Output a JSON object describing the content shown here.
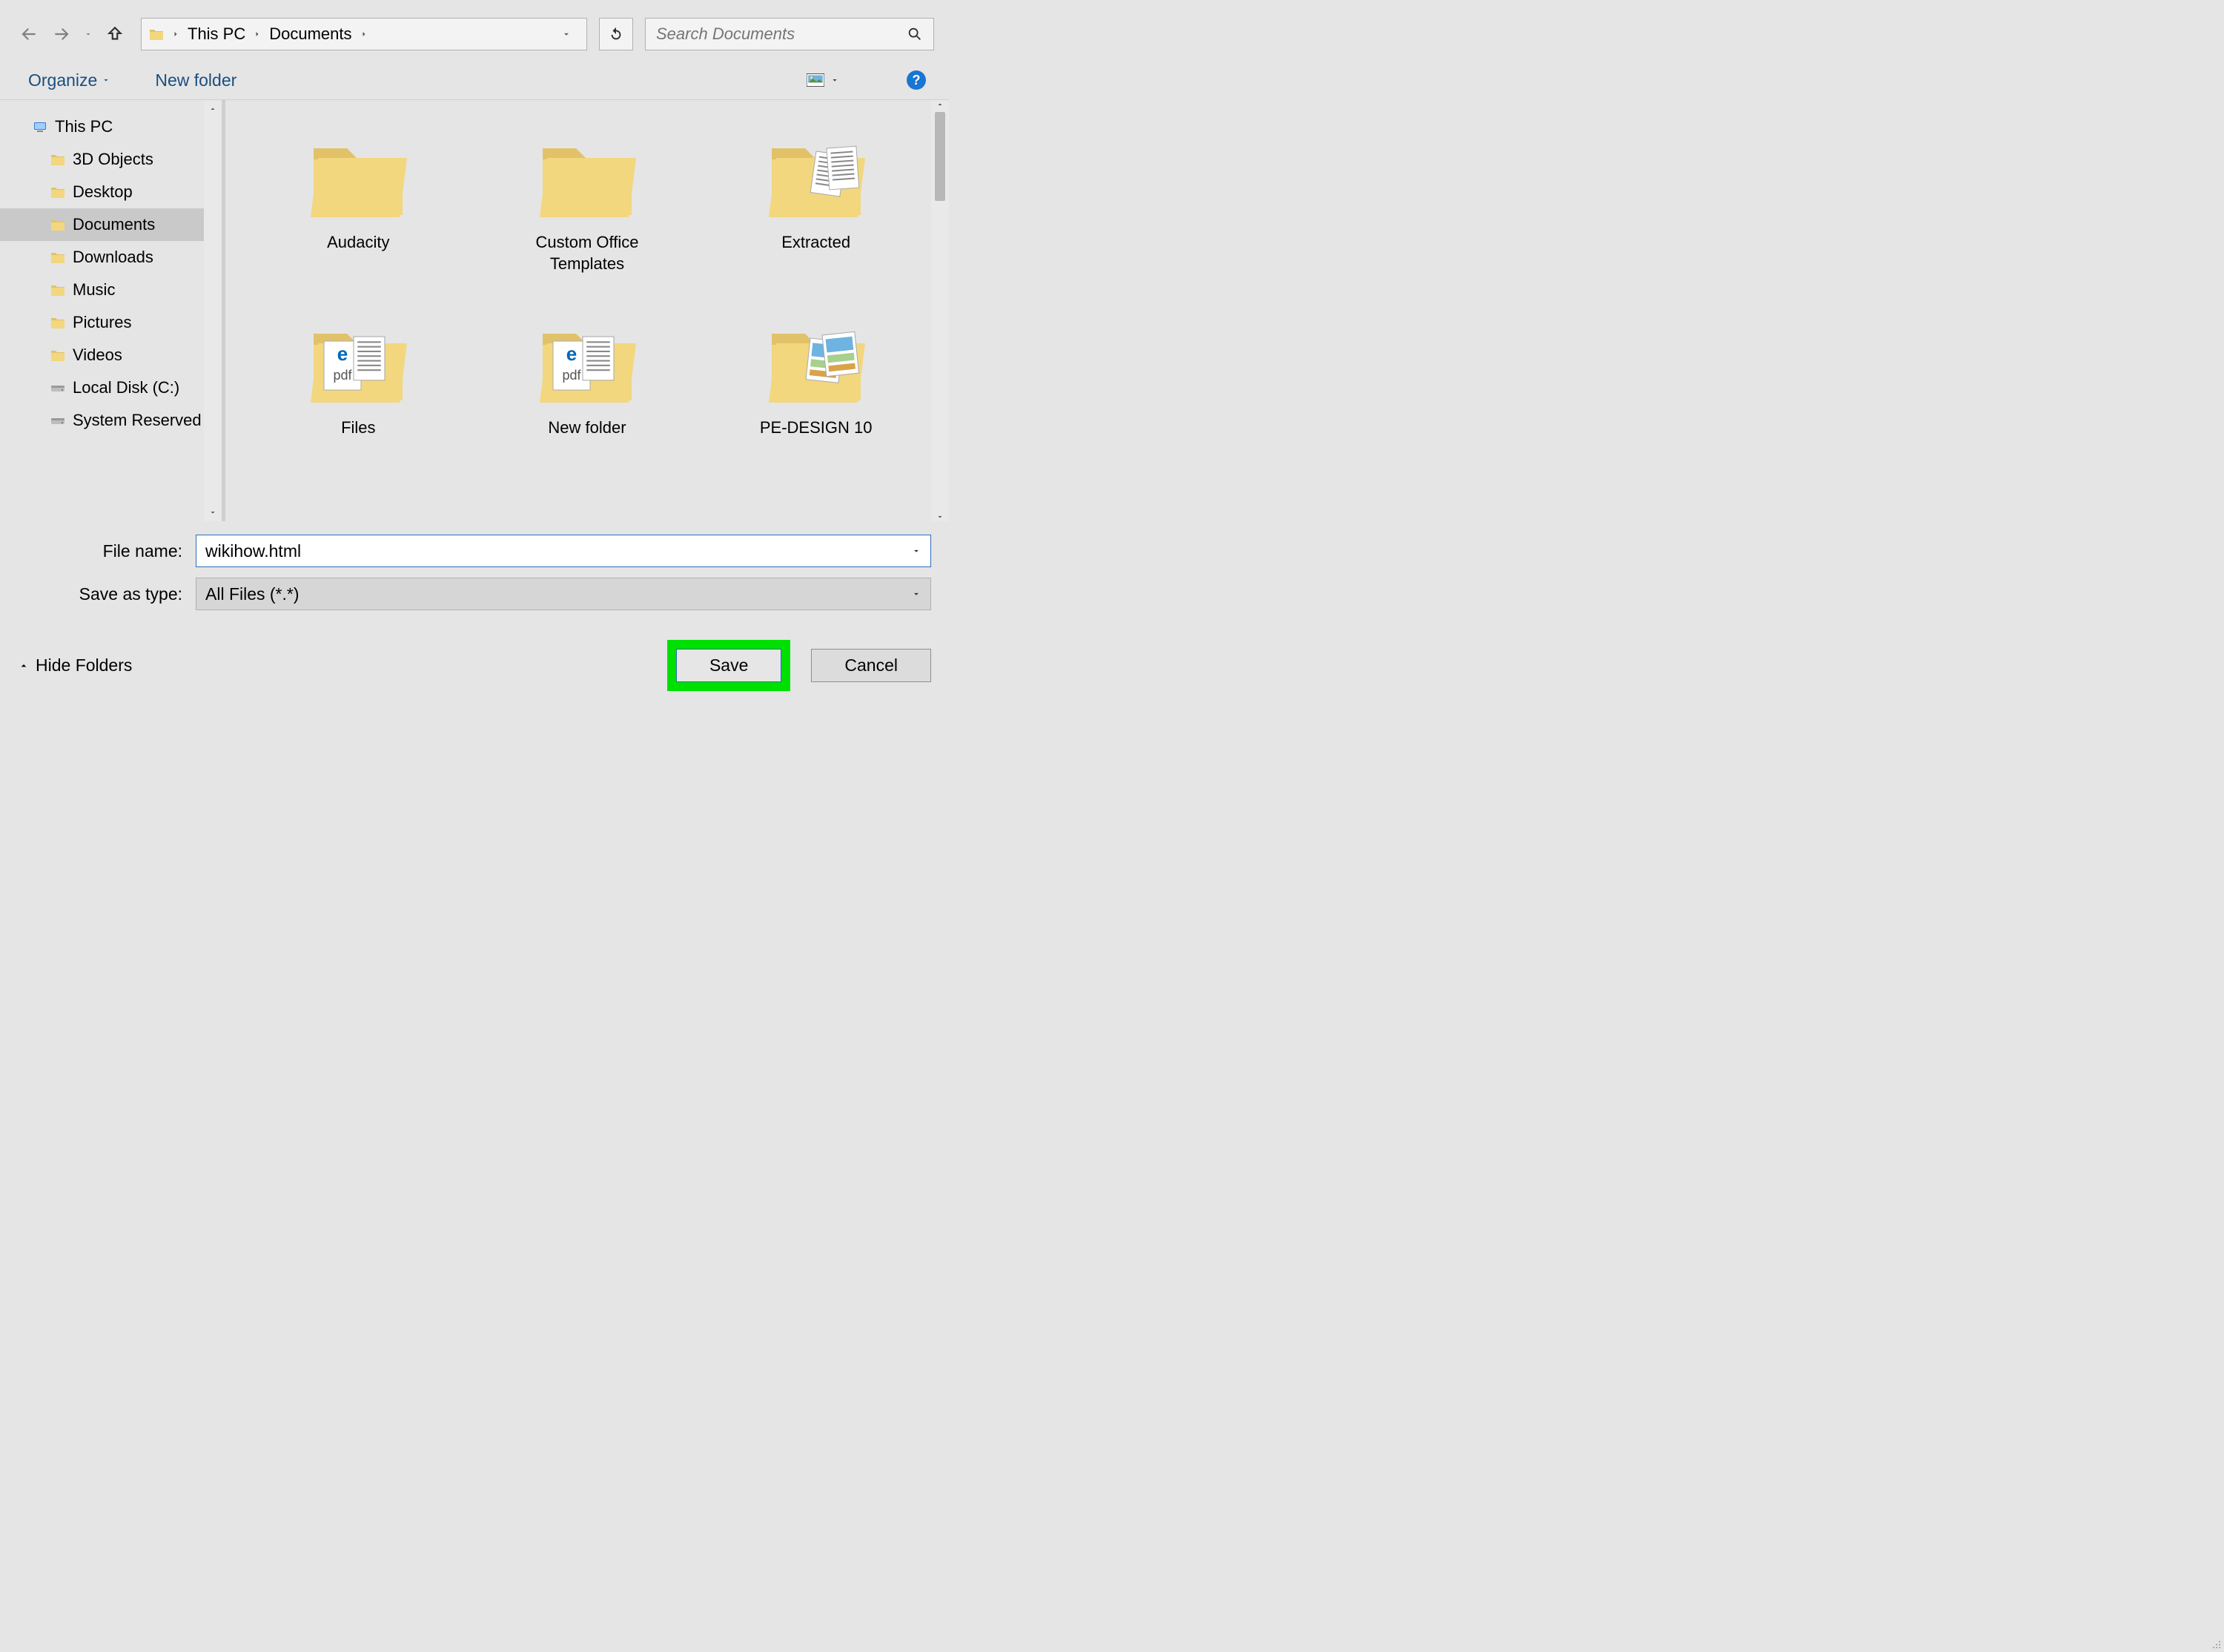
{
  "address": {
    "segments": [
      "This PC",
      "Documents"
    ]
  },
  "search": {
    "placeholder": "Search Documents"
  },
  "toolbar": {
    "organize_label": "Organize",
    "new_folder_label": "New folder"
  },
  "tree": {
    "items": [
      {
        "label": "This PC",
        "icon": "pc"
      },
      {
        "label": "3D Objects",
        "icon": "folder"
      },
      {
        "label": "Desktop",
        "icon": "folder"
      },
      {
        "label": "Documents",
        "icon": "folder",
        "selected": true
      },
      {
        "label": "Downloads",
        "icon": "folder"
      },
      {
        "label": "Music",
        "icon": "folder"
      },
      {
        "label": "Pictures",
        "icon": "folder"
      },
      {
        "label": "Videos",
        "icon": "folder"
      },
      {
        "label": "Local Disk (C:)",
        "icon": "drive"
      },
      {
        "label": "System Reserved",
        "icon": "drive"
      }
    ]
  },
  "files": [
    {
      "label": "Audacity",
      "icon": "folder"
    },
    {
      "label": "Custom Office Templates",
      "icon": "folder"
    },
    {
      "label": "Extracted",
      "icon": "folder-doc"
    },
    {
      "label": "Files",
      "icon": "folder-edge-pdf"
    },
    {
      "label": "New folder",
      "icon": "folder-edge-pdf"
    },
    {
      "label": "PE-DESIGN 10",
      "icon": "folder-images"
    }
  ],
  "form": {
    "filename_label": "File name:",
    "type_label": "Save as type:",
    "filename_value": "wikihow.html",
    "type_value": "All Files  (*.*)"
  },
  "footer": {
    "hide_folders_label": "Hide Folders",
    "save_label": "Save",
    "cancel_label": "Cancel"
  }
}
